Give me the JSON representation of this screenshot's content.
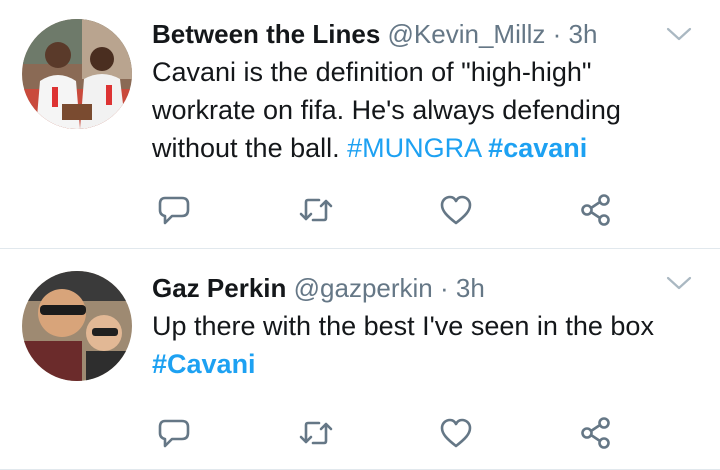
{
  "tweets": [
    {
      "display_name": "Between the Lines",
      "handle": "@Kevin_Millz",
      "separator": "·",
      "time": "3h",
      "text_parts": [
        "Cavani is the definition of \"high-high\" workrate on fifa. He's always defending without the ball. ",
        "#MUNGRA",
        " ",
        "#cavani"
      ]
    },
    {
      "display_name": "Gaz Perkin",
      "handle": "@gazperkin",
      "separator": "·",
      "time": "3h",
      "text_parts": [
        "Up there with the best I've seen in the box ",
        "#Cavani"
      ]
    }
  ],
  "colors": {
    "link": "#1da1f2",
    "icon": "#657786",
    "divider": "#e1e8ed"
  },
  "icons": [
    "chevron-down-icon",
    "reply-icon",
    "retweet-icon",
    "like-icon",
    "share-icon"
  ]
}
